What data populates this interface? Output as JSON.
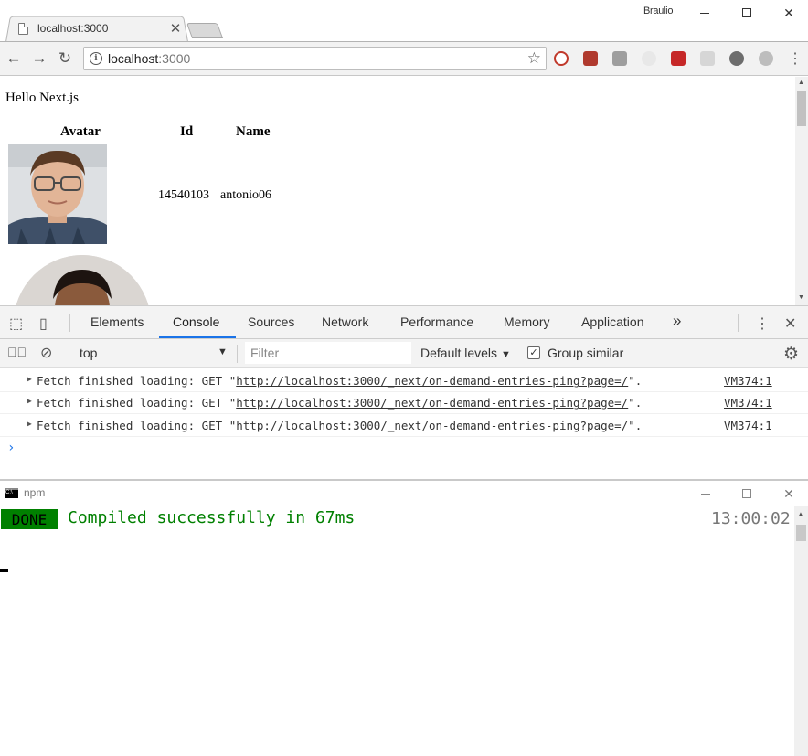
{
  "window": {
    "user": "Braulio"
  },
  "tab": {
    "title": "localhost:3000"
  },
  "omnibox": {
    "host": "localhost",
    "port": ":3000"
  },
  "page": {
    "title": "Hello Next.js",
    "table": {
      "headers": [
        "Avatar",
        "Id",
        "Name"
      ],
      "rows": [
        {
          "id": "14540103",
          "name": "antonio06"
        }
      ]
    }
  },
  "devtools": {
    "tabs": [
      "Elements",
      "Console",
      "Sources",
      "Network",
      "Performance",
      "Memory",
      "Application"
    ],
    "active_tab": "Console",
    "more": "»",
    "context": "top",
    "filter_placeholder": "Filter",
    "levels": "Default levels",
    "group_similar": "Group similar",
    "console": [
      {
        "prefix": "Fetch finished loading: GET \"",
        "url": "http://localhost:3000/_next/on-demand-entries-ping?page=/",
        "suffix": "\".",
        "source": "VM374:1"
      },
      {
        "prefix": "Fetch finished loading: GET \"",
        "url": "http://localhost:3000/_next/on-demand-entries-ping?page=/",
        "suffix": "\".",
        "source": "VM374:1"
      },
      {
        "prefix": "Fetch finished loading: GET \"",
        "url": "http://localhost:3000/_next/on-demand-entries-ping?page=/",
        "suffix": "\".",
        "source": "VM374:1"
      }
    ]
  },
  "terminal": {
    "title": "npm",
    "badge": "DONE",
    "message": "Compiled successfully in 67ms",
    "time": "13:00:02"
  },
  "colors": {
    "done_green": "#008000",
    "devtools_accent": "#1a73e8"
  }
}
